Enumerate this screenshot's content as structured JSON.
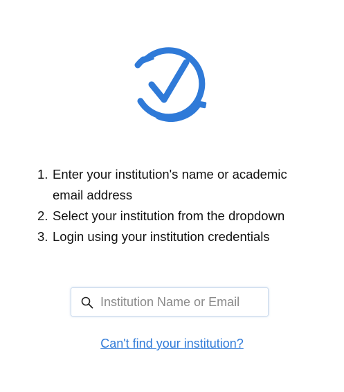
{
  "logo": {
    "icon": "circular-check-icon",
    "color": "#2f7ad8"
  },
  "steps": [
    {
      "number": "1.",
      "text": "Enter your institution's name or academic email address"
    },
    {
      "number": "2.",
      "text": "Select your institution from the dropdown"
    },
    {
      "number": "3.",
      "text": "Login using your institution credentials"
    }
  ],
  "search": {
    "icon": "search-icon",
    "placeholder": "Institution Name or Email",
    "value": ""
  },
  "help_link": {
    "label": "Can't find your institution?",
    "color": "#2f7ad8"
  }
}
